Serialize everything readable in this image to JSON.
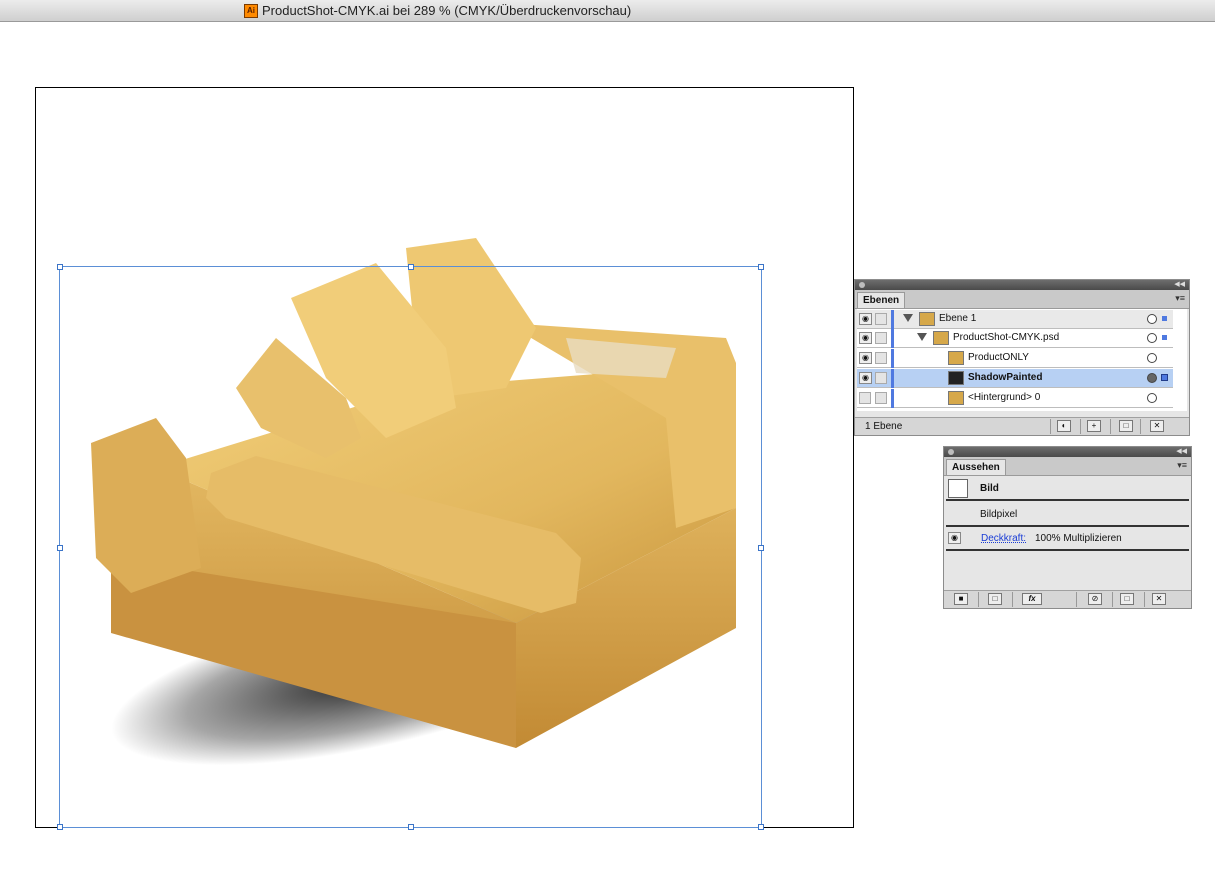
{
  "window": {
    "title": "ProductShot-CMYK.ai bei 289 % (CMYK/Überdruckenvorschau)",
    "app_icon": "illustrator-icon",
    "app_icon_text": "Ai"
  },
  "layers_panel": {
    "tab": "Ebenen",
    "menu_icon": "panel-menu-icon",
    "layers": [
      {
        "name": "Ebene 1",
        "selected": false
      },
      {
        "name": "ProductShot-CMYK.psd",
        "selected": false
      },
      {
        "name": "ProductONLY",
        "selected": false
      },
      {
        "name": "ShadowPainted",
        "selected": true
      },
      {
        "name": "<Hintergrund> 0",
        "selected": false
      }
    ],
    "footer_count": "1 Ebene",
    "footer_buttons": [
      "make-clipping-mask-icon",
      "create-sublayer-icon",
      "new-layer-icon",
      "trash-icon"
    ]
  },
  "appearance_panel": {
    "tab": "Aussehen",
    "object_type": "Bild",
    "content": "Bildpixel",
    "opacity_label": "Deckkraft:",
    "opacity_value": "100% Multiplizieren",
    "fx_label": "fx"
  },
  "colors": {
    "selection": "#5b8fd6",
    "layer_color": "#4f79e0",
    "selected_row": "#b7d0f3"
  }
}
